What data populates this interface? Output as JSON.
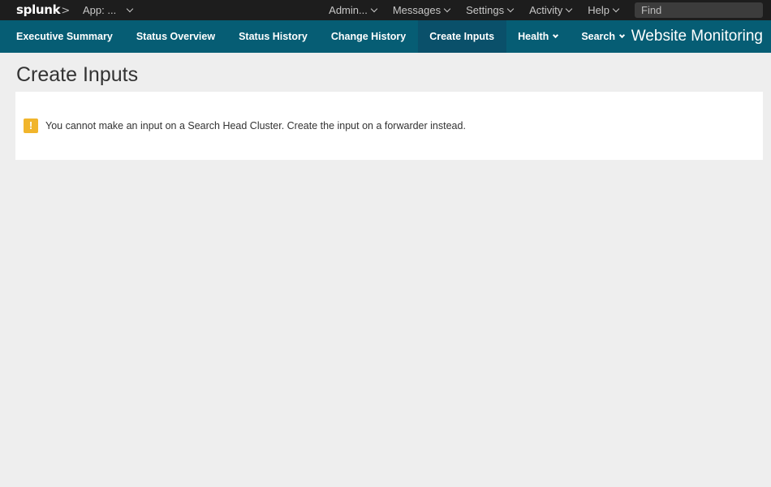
{
  "topbar": {
    "logo": "splunk",
    "logo_chevron": ">",
    "app_menu_label": "App: ...",
    "nav": [
      {
        "label": "Admin..."
      },
      {
        "label": "Messages"
      },
      {
        "label": "Settings"
      },
      {
        "label": "Activity"
      },
      {
        "label": "Help"
      }
    ],
    "find_placeholder": "Find"
  },
  "appbar": {
    "tabs": [
      {
        "label": "Executive Summary"
      },
      {
        "label": "Status Overview"
      },
      {
        "label": "Status History"
      },
      {
        "label": "Change History"
      },
      {
        "label": "Create Inputs"
      },
      {
        "label": "Health"
      },
      {
        "label": "Search"
      }
    ],
    "app_title": "Website Monitoring"
  },
  "page": {
    "title": "Create Inputs",
    "warning_icon_glyph": "!",
    "warning_message": "You cannot make an input on a Search Head Cluster. Create the input on a forwarder instead."
  },
  "colors": {
    "topbar_bg": "#1d1d1d",
    "appbar_bg": "#065d74",
    "active_tab_bg": "#0a506a",
    "warning": "#f1b52c",
    "page_bg": "#eeeeee"
  }
}
